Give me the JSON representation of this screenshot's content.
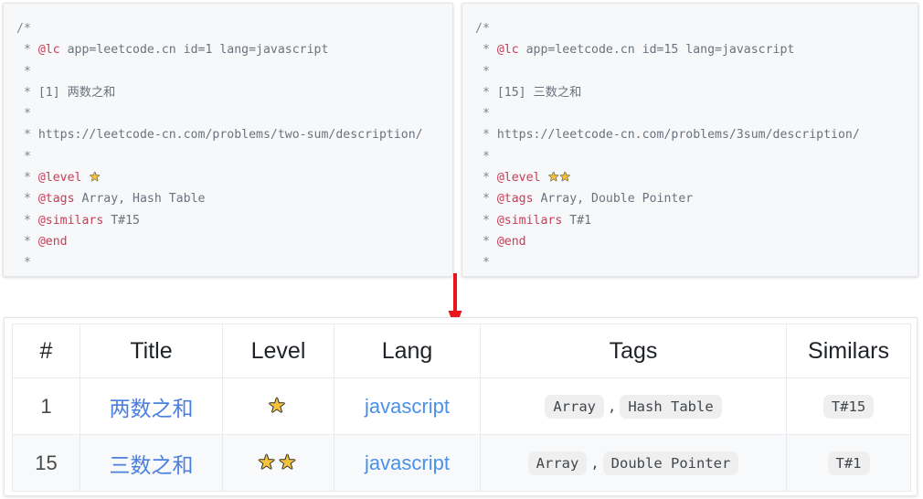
{
  "colors": {
    "accent_link": "#4a90e8",
    "title_link": "#4a7fe0",
    "annotation_red": "#cc3b55",
    "arrow_red": "#e8161a",
    "code_bg": "#f7f8fa",
    "badge_bg": "#efefef",
    "star_gold": "#f5c33b",
    "row_alt_bg": "#f8f9fa"
  },
  "code_panels": [
    {
      "name": "two-sum-header-comment",
      "lines": [
        {
          "parts": [
            {
              "t": "cmt",
              "s": "/*"
            }
          ]
        },
        {
          "parts": [
            {
              "t": "cmt",
              "s": " * "
            },
            {
              "t": "at",
              "s": "@lc"
            },
            {
              "t": "txt",
              "s": " app=leetcode.cn id=1 lang=javascript"
            }
          ]
        },
        {
          "parts": [
            {
              "t": "cmt",
              "s": " *"
            }
          ]
        },
        {
          "parts": [
            {
              "t": "cmt",
              "s": " * "
            },
            {
              "t": "txt",
              "s": "[1] 两数之和"
            }
          ]
        },
        {
          "parts": [
            {
              "t": "cmt",
              "s": " *"
            }
          ]
        },
        {
          "parts": [
            {
              "t": "cmt",
              "s": " * "
            },
            {
              "t": "txt",
              "s": "https://leetcode-cn.com/problems/two-sum/description/"
            }
          ]
        },
        {
          "parts": [
            {
              "t": "cmt",
              "s": " *"
            }
          ]
        },
        {
          "parts": [
            {
              "t": "cmt",
              "s": " * "
            },
            {
              "t": "at",
              "s": "@level"
            },
            {
              "t": "txt",
              "s": " "
            },
            {
              "t": "star",
              "s": "★"
            }
          ]
        },
        {
          "parts": [
            {
              "t": "cmt",
              "s": " * "
            },
            {
              "t": "at",
              "s": "@tags"
            },
            {
              "t": "txt",
              "s": " Array, Hash Table"
            }
          ]
        },
        {
          "parts": [
            {
              "t": "cmt",
              "s": " * "
            },
            {
              "t": "at",
              "s": "@similars"
            },
            {
              "t": "txt",
              "s": " T#15"
            }
          ]
        },
        {
          "parts": [
            {
              "t": "cmt",
              "s": " * "
            },
            {
              "t": "at",
              "s": "@end"
            }
          ]
        },
        {
          "parts": [
            {
              "t": "cmt",
              "s": " *"
            }
          ]
        },
        {
          "parts": [
            {
              "t": "cmt",
              "s": " */"
            }
          ]
        }
      ]
    },
    {
      "name": "3sum-header-comment",
      "lines": [
        {
          "parts": [
            {
              "t": "cmt",
              "s": "/*"
            }
          ]
        },
        {
          "parts": [
            {
              "t": "cmt",
              "s": " * "
            },
            {
              "t": "at",
              "s": "@lc"
            },
            {
              "t": "txt",
              "s": " app=leetcode.cn id=15 lang=javascript"
            }
          ]
        },
        {
          "parts": [
            {
              "t": "cmt",
              "s": " *"
            }
          ]
        },
        {
          "parts": [
            {
              "t": "cmt",
              "s": " * "
            },
            {
              "t": "txt",
              "s": "[15] 三数之和"
            }
          ]
        },
        {
          "parts": [
            {
              "t": "cmt",
              "s": " *"
            }
          ]
        },
        {
          "parts": [
            {
              "t": "cmt",
              "s": " * "
            },
            {
              "t": "txt",
              "s": "https://leetcode-cn.com/problems/3sum/description/"
            }
          ]
        },
        {
          "parts": [
            {
              "t": "cmt",
              "s": " *"
            }
          ]
        },
        {
          "parts": [
            {
              "t": "cmt",
              "s": " * "
            },
            {
              "t": "at",
              "s": "@level"
            },
            {
              "t": "txt",
              "s": " "
            },
            {
              "t": "star",
              "s": "★★"
            }
          ]
        },
        {
          "parts": [
            {
              "t": "cmt",
              "s": " * "
            },
            {
              "t": "at",
              "s": "@tags"
            },
            {
              "t": "txt",
              "s": " Array, Double Pointer"
            }
          ]
        },
        {
          "parts": [
            {
              "t": "cmt",
              "s": " * "
            },
            {
              "t": "at",
              "s": "@similars"
            },
            {
              "t": "txt",
              "s": " T#1"
            }
          ]
        },
        {
          "parts": [
            {
              "t": "cmt",
              "s": " * "
            },
            {
              "t": "at",
              "s": "@end"
            }
          ]
        },
        {
          "parts": [
            {
              "t": "cmt",
              "s": " *"
            }
          ]
        },
        {
          "parts": [
            {
              "t": "cmt",
              "s": " */"
            }
          ]
        }
      ]
    }
  ],
  "arrow": {
    "name": "down-arrow",
    "direction": "down",
    "color": "#e8161a"
  },
  "table": {
    "columns": [
      {
        "key": "num",
        "label": "#"
      },
      {
        "key": "title",
        "label": "Title"
      },
      {
        "key": "level",
        "label": "Level"
      },
      {
        "key": "lang",
        "label": "Lang"
      },
      {
        "key": "tags",
        "label": "Tags"
      },
      {
        "key": "sim",
        "label": "Similars"
      }
    ],
    "rows": [
      {
        "num": "1",
        "title": "两数之和",
        "level": "★",
        "level_count": 1,
        "lang": "javascript",
        "tags": [
          "Array",
          "Hash Table"
        ],
        "tag_separator": ",",
        "similars": [
          "T#15"
        ]
      },
      {
        "num": "15",
        "title": "三数之和",
        "level": "★★",
        "level_count": 2,
        "lang": "javascript",
        "tags": [
          "Array",
          "Double Pointer"
        ],
        "tag_separator": ",",
        "similars": [
          "T#1"
        ]
      }
    ]
  }
}
